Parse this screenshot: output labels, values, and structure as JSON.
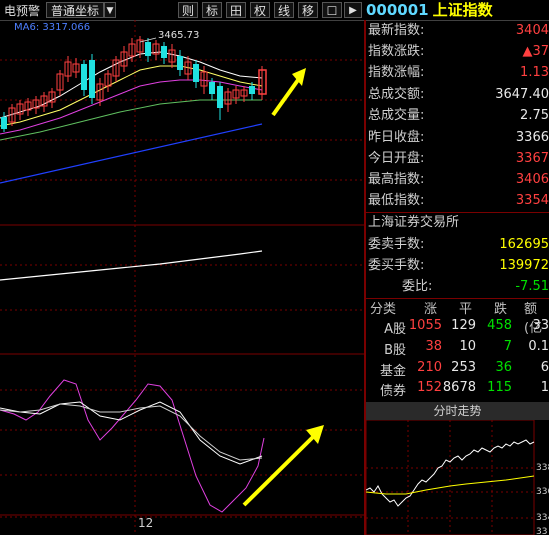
{
  "toolbar": {
    "warn_label": "电预警",
    "coord_label": "普通坐标",
    "dropdown_arrow": "▼",
    "btn_ce": "则",
    "btn_biao": "标",
    "btn_tian": "田",
    "btn_quan": "权",
    "btn_xian": "线",
    "btn_yi": "移",
    "btn_box": "☐",
    "btn_play": "▶",
    "stock_code": "000001",
    "stock_name": "上证指数"
  },
  "chart": {
    "ma_legend": "MA6: 3317.066",
    "high_price_label": "3465.73",
    "date_label": "12"
  },
  "quote": {
    "rows": [
      {
        "label": "最新指数:",
        "value": "3404",
        "color": "red"
      },
      {
        "label": "指数涨跌:",
        "value": "▲37",
        "color": "red"
      },
      {
        "label": "指数涨幅:",
        "value": "1.13",
        "color": "red"
      },
      {
        "label": "总成交额:",
        "value": "3647.40",
        "color": "white"
      },
      {
        "label": "总成交量:",
        "value": "2.75",
        "color": "white"
      },
      {
        "label": "昨日收盘:",
        "value": "3366",
        "color": "white"
      },
      {
        "label": "今日开盘:",
        "value": "3367",
        "color": "red"
      },
      {
        "label": "最高指数:",
        "value": "3406",
        "color": "red"
      },
      {
        "label": "最低指数:",
        "value": "3354",
        "color": "red"
      }
    ],
    "exchange": "上海证券交易所",
    "orders": [
      {
        "label": "委卖手数:",
        "value": "162695",
        "color": "yellow"
      },
      {
        "label": "委买手数:",
        "value": "139972",
        "color": "yellow"
      },
      {
        "label": "委比:",
        "value": "-7.51",
        "color": "green"
      }
    ]
  },
  "breadth": {
    "headers": [
      "分类",
      "涨",
      "平",
      "跌",
      "额(亿"
    ],
    "rows": [
      {
        "label": "A股",
        "up": "1055",
        "flat": "129",
        "down": "458",
        "amt": "33"
      },
      {
        "label": "B股",
        "up": "38",
        "flat": "10",
        "down": "7",
        "amt": "0.1"
      },
      {
        "label": "基金",
        "up": "210",
        "flat": "253",
        "down": "36",
        "amt": "6"
      },
      {
        "label": "债券",
        "up": "152",
        "flat": "8678",
        "down": "115",
        "amt": "1"
      }
    ]
  },
  "intraday": {
    "title": "分时走势",
    "axis_labels": [
      "338",
      "336",
      "334",
      "33"
    ]
  },
  "colors": {
    "up": "#ff4040",
    "down": "#00e000",
    "accent": "#ffff00",
    "code": "#5fd8ff",
    "divider": "#7a0000"
  }
}
